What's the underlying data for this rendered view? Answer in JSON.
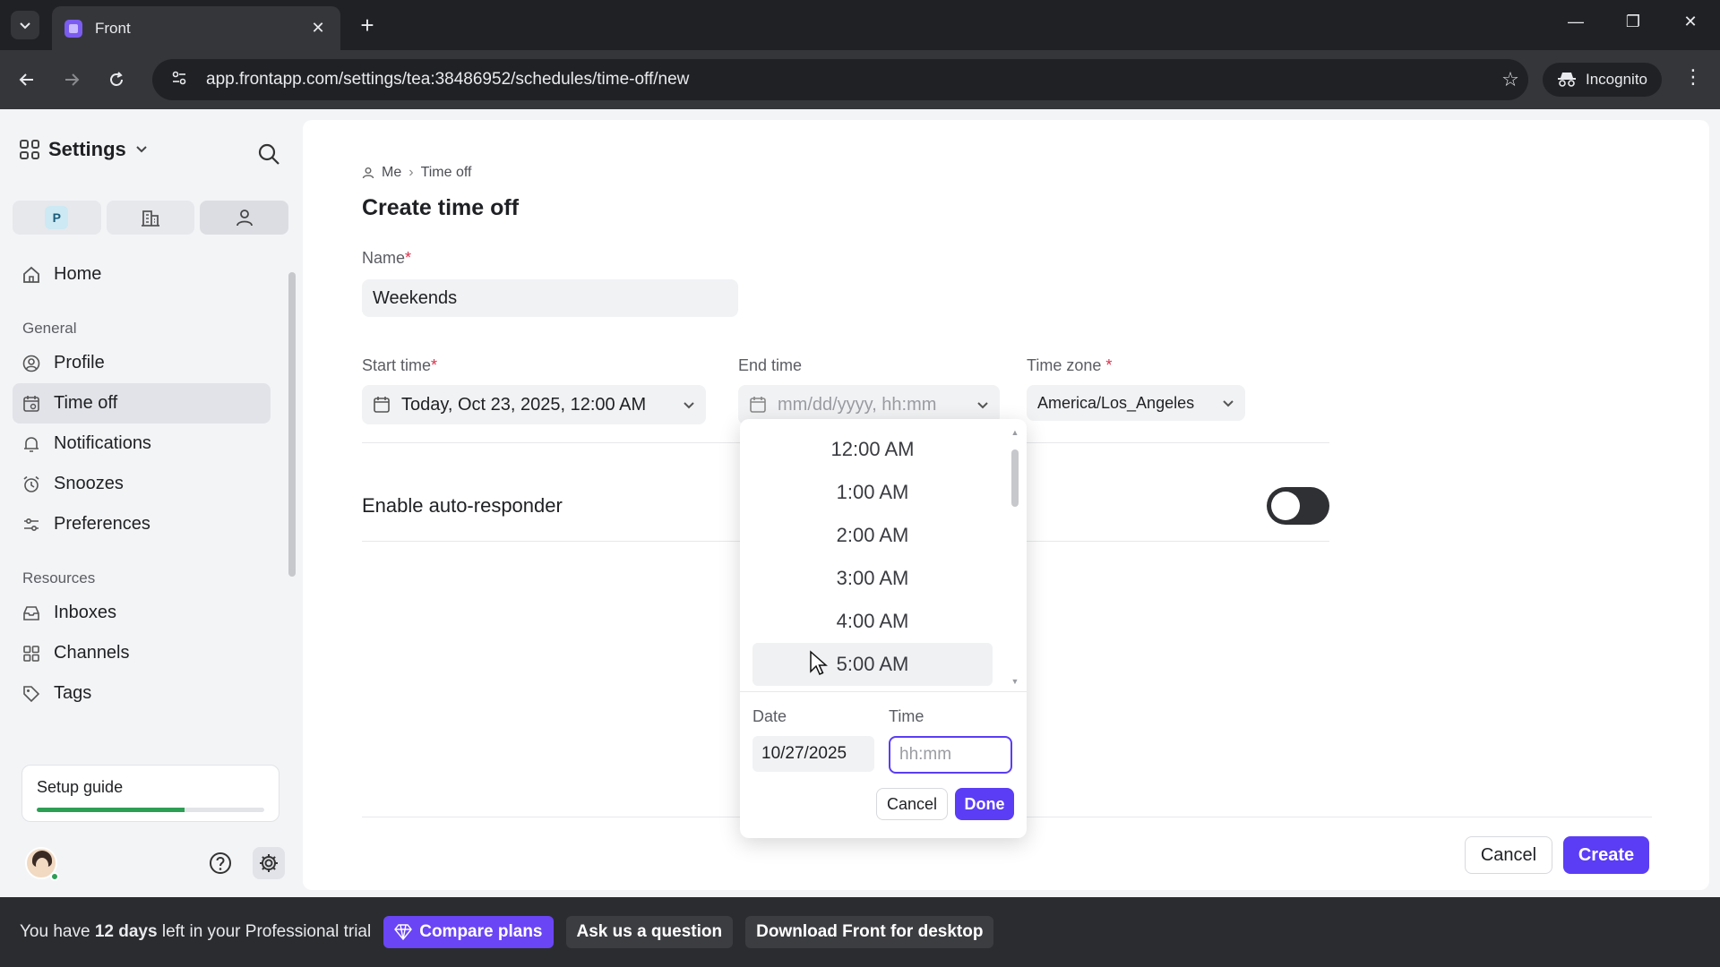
{
  "browser": {
    "tab_title": "Front",
    "url": "app.frontapp.com/settings/tea:38486952/schedules/time-off/new",
    "incognito_label": "Incognito"
  },
  "sidebar": {
    "title": "Settings",
    "scope_badge": "P",
    "items_top": [
      {
        "label": "Home",
        "icon": "home-icon"
      }
    ],
    "general_label": "General",
    "general_items": [
      {
        "label": "Profile",
        "icon": "profile-icon"
      },
      {
        "label": "Time off",
        "icon": "calendar-icon",
        "active": true
      },
      {
        "label": "Notifications",
        "icon": "bell-icon"
      },
      {
        "label": "Snoozes",
        "icon": "alarm-clock-icon"
      },
      {
        "label": "Preferences",
        "icon": "sliders-icon"
      }
    ],
    "resources_label": "Resources",
    "resources_items": [
      {
        "label": "Inboxes",
        "icon": "inbox-icon"
      },
      {
        "label": "Channels",
        "icon": "channels-icon"
      },
      {
        "label": "Tags",
        "icon": "tag-icon"
      }
    ],
    "setup_guide": {
      "label": "Setup guide",
      "progress": 0.65
    }
  },
  "main": {
    "breadcrumb": {
      "root": "Me",
      "current": "Time off"
    },
    "title": "Create time off",
    "name_label": "Name",
    "name_value": "Weekends",
    "start_label": "Start time",
    "start_value": "Today, Oct 23, 2025, 12:00 AM",
    "end_label": "End time",
    "end_placeholder": "mm/dd/yyyy, hh:mm",
    "tz_label": "Time zone",
    "tz_value": "America/Los_Angeles",
    "auto_responder_label": "Enable auto-responder",
    "auto_responder_on": false,
    "cancel_label": "Cancel",
    "create_label": "Create"
  },
  "picker": {
    "times": [
      "12:00 AM",
      "1:00 AM",
      "2:00 AM",
      "3:00 AM",
      "4:00 AM",
      "5:00 AM"
    ],
    "hovered_index": 5,
    "date_label": "Date",
    "time_label": "Time",
    "date_value": "10/27/2025",
    "time_placeholder": "hh:mm",
    "cancel_label": "Cancel",
    "done_label": "Done"
  },
  "banner": {
    "prefix": "You have",
    "days": "12 days",
    "suffix": "left in your Professional trial",
    "compare_label": "Compare plans",
    "ask_label": "Ask us a question",
    "download_label": "Download Front for desktop"
  },
  "colors": {
    "accent": "#5b3df5",
    "progress": "#2e9e55",
    "required": "#d6334c"
  }
}
